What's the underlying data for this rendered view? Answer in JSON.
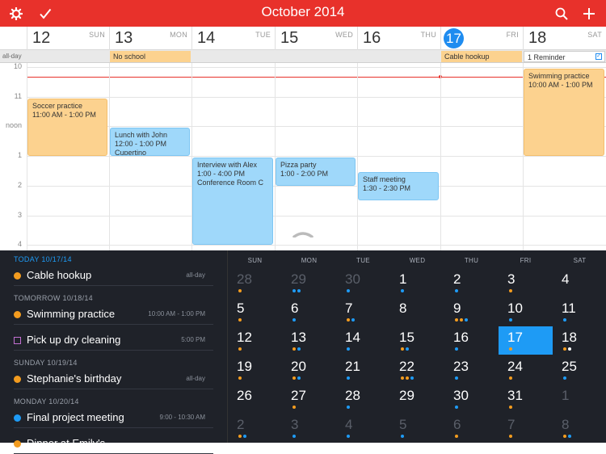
{
  "topbar": {
    "title": "October 2014",
    "color": "#e8312b",
    "icons": [
      "gear-icon",
      "check-icon",
      "search-icon",
      "plus-icon"
    ]
  },
  "week": {
    "days": [
      {
        "num": "12",
        "dow": "SUN"
      },
      {
        "num": "13",
        "dow": "MON"
      },
      {
        "num": "14",
        "dow": "TUE"
      },
      {
        "num": "15",
        "dow": "WED"
      },
      {
        "num": "16",
        "dow": "THU"
      },
      {
        "num": "17",
        "dow": "FRI",
        "today": true
      },
      {
        "num": "18",
        "dow": "SAT"
      }
    ]
  },
  "allday": {
    "label": "all-day",
    "events": [
      {
        "title": "No school",
        "day": 1
      },
      {
        "title": "Cable hookup",
        "day": 5
      },
      {
        "title": "1 Reminder",
        "day": 6,
        "type": "reminder"
      }
    ]
  },
  "grid": {
    "hours": [
      "10",
      "11",
      "noon",
      "1",
      "2",
      "3",
      "4"
    ],
    "events": [
      {
        "title": "Soccer practice",
        "time": "11:00 AM - 1:00 PM",
        "location": "",
        "day": 0,
        "start": 11.0,
        "end": 13.0,
        "color": "orange"
      },
      {
        "title": "Lunch with John",
        "time": "12:00 - 1:00 PM",
        "location": "Cupertino",
        "day": 1,
        "start": 12.0,
        "end": 13.0,
        "color": "blue"
      },
      {
        "title": "Interview with Alex",
        "time": "1:00 - 4:00 PM",
        "location": "Conference Room C",
        "day": 2,
        "start": 13.0,
        "end": 16.0,
        "color": "blue"
      },
      {
        "title": "Pizza party",
        "time": "1:00 - 2:00 PM",
        "location": "",
        "day": 3,
        "start": 13.0,
        "end": 14.0,
        "color": "blue"
      },
      {
        "title": "Staff meeting",
        "time": "1:30 - 2:30 PM",
        "location": "",
        "day": 4,
        "start": 13.5,
        "end": 14.5,
        "color": "blue"
      },
      {
        "title": "Swimming practice",
        "time": "10:00 AM - 1:00 PM",
        "location": "",
        "day": 6,
        "start": 10.0,
        "end": 13.0,
        "color": "orange"
      }
    ]
  },
  "agenda": {
    "sections": [
      {
        "day": "TODAY",
        "date": "10/17/14",
        "items": [
          {
            "name": "Cable hookup",
            "time": "all-day",
            "color": "#f39c1f",
            "kind": "dot"
          }
        ]
      },
      {
        "day": "TOMORROW",
        "date": "10/18/14",
        "items": [
          {
            "name": "Swimming practice",
            "time": "10:00 AM - 1:00 PM",
            "color": "#f39c1f",
            "kind": "dot"
          },
          {
            "name": "Pick up dry cleaning",
            "time": "5:00 PM",
            "color": "#c26fd1",
            "kind": "square"
          }
        ]
      },
      {
        "day": "SUNDAY",
        "date": "10/19/14",
        "items": [
          {
            "name": "Stephanie's birthday",
            "time": "all-day",
            "color": "#f39c1f",
            "kind": "dot"
          }
        ]
      },
      {
        "day": "MONDAY",
        "date": "10/20/14",
        "items": [
          {
            "name": "Final project meeting",
            "time": "9:00 - 10:30 AM",
            "color": "#1e9bf5",
            "kind": "dot"
          },
          {
            "name": "Dinner at Emily's",
            "time": "",
            "color": "#f39c1f",
            "kind": "dot"
          }
        ]
      }
    ]
  },
  "month": {
    "dows": [
      "SUN",
      "MON",
      "TUE",
      "WED",
      "THU",
      "FRI",
      "SAT"
    ],
    "weeks": [
      [
        {
          "n": "28",
          "dim": true,
          "dots": [
            "#f39c1f"
          ]
        },
        {
          "n": "29",
          "dim": true,
          "dots": [
            "#1e9bf5",
            "#1e9bf5"
          ]
        },
        {
          "n": "30",
          "dim": true,
          "dots": [
            "#1e9bf5"
          ]
        },
        {
          "n": "1",
          "dots": [
            "#1e9bf5"
          ]
        },
        {
          "n": "2",
          "dots": [
            "#1e9bf5"
          ]
        },
        {
          "n": "3",
          "dots": [
            "#f39c1f"
          ]
        },
        {
          "n": "4",
          "dots": []
        }
      ],
      [
        {
          "n": "5",
          "dots": [
            "#f39c1f"
          ]
        },
        {
          "n": "6",
          "dots": [
            "#1e9bf5"
          ]
        },
        {
          "n": "7",
          "dots": [
            "#f39c1f",
            "#1e9bf5"
          ]
        },
        {
          "n": "8",
          "dots": []
        },
        {
          "n": "9",
          "dots": [
            "#f39c1f",
            "#f39c1f",
            "#1e9bf5"
          ]
        },
        {
          "n": "10",
          "dots": [
            "#1e9bf5"
          ]
        },
        {
          "n": "11",
          "dots": [
            "#1e9bf5"
          ]
        }
      ],
      [
        {
          "n": "12",
          "dots": [
            "#f39c1f"
          ]
        },
        {
          "n": "13",
          "dots": [
            "#f39c1f",
            "#1e9bf5"
          ]
        },
        {
          "n": "14",
          "dots": [
            "#1e9bf5"
          ]
        },
        {
          "n": "15",
          "dots": [
            "#f39c1f",
            "#1e9bf5"
          ]
        },
        {
          "n": "16",
          "dots": [
            "#1e9bf5"
          ]
        },
        {
          "n": "17",
          "sel": true,
          "dots": [
            "#f39c1f"
          ]
        },
        {
          "n": "18",
          "dots": [
            "#f39c1f",
            "#ffffff"
          ]
        }
      ],
      [
        {
          "n": "19",
          "dots": [
            "#f39c1f"
          ]
        },
        {
          "n": "20",
          "dots": [
            "#f39c1f",
            "#1e9bf5"
          ]
        },
        {
          "n": "21",
          "dots": [
            "#1e9bf5"
          ]
        },
        {
          "n": "22",
          "dots": [
            "#f39c1f",
            "#f39c1f",
            "#1e9bf5"
          ]
        },
        {
          "n": "23",
          "dots": [
            "#1e9bf5"
          ]
        },
        {
          "n": "24",
          "dots": [
            "#f39c1f"
          ]
        },
        {
          "n": "25",
          "dots": [
            "#1e9bf5"
          ]
        }
      ],
      [
        {
          "n": "26",
          "dots": []
        },
        {
          "n": "27",
          "dots": [
            "#f39c1f"
          ]
        },
        {
          "n": "28",
          "dots": [
            "#1e9bf5"
          ]
        },
        {
          "n": "29",
          "dots": []
        },
        {
          "n": "30",
          "dots": [
            "#1e9bf5"
          ]
        },
        {
          "n": "31",
          "dots": [
            "#f39c1f"
          ]
        },
        {
          "n": "1",
          "dim": true,
          "dots": []
        }
      ],
      [
        {
          "n": "2",
          "dim": true,
          "dots": [
            "#f39c1f",
            "#1e9bf5"
          ]
        },
        {
          "n": "3",
          "dim": true,
          "dots": [
            "#1e9bf5"
          ]
        },
        {
          "n": "4",
          "dim": true,
          "dots": [
            "#1e9bf5"
          ]
        },
        {
          "n": "5",
          "dim": true,
          "dots": [
            "#1e9bf5"
          ]
        },
        {
          "n": "6",
          "dim": true,
          "dots": [
            "#f39c1f"
          ]
        },
        {
          "n": "7",
          "dim": true,
          "dots": [
            "#f39c1f"
          ]
        },
        {
          "n": "8",
          "dim": true,
          "dots": [
            "#f39c1f",
            "#1e9bf5"
          ]
        }
      ]
    ]
  }
}
